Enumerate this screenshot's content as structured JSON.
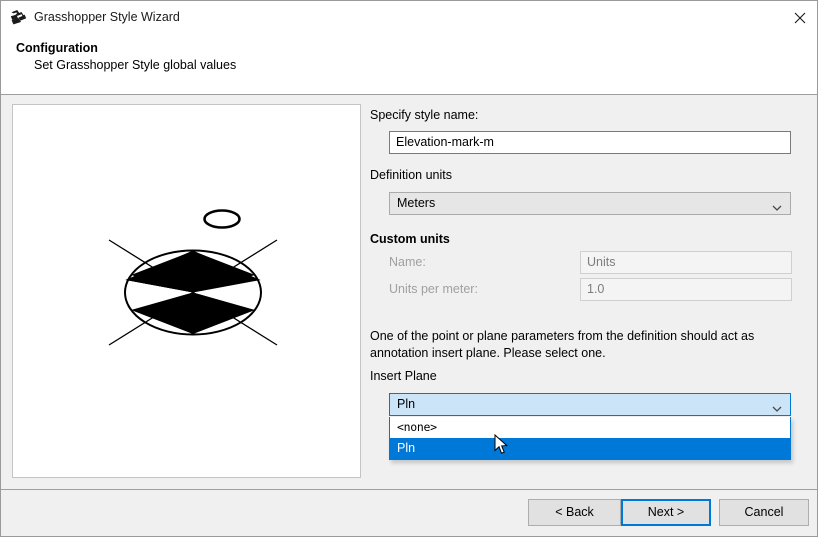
{
  "window": {
    "title": "Grasshopper Style Wizard",
    "app_icon": "grasshopper-icon",
    "close_label": "✕"
  },
  "header": {
    "title": "Configuration",
    "subtitle": "Set Grasshopper Style global values"
  },
  "preview": {
    "name": "style-preview-elevation-mark"
  },
  "form": {
    "style_name_label": "Specify style name:",
    "style_name_value": "Elevation-mark-m",
    "definition_units_label": "Definition units",
    "definition_units_value": "Meters",
    "custom_units_label": "Custom units",
    "custom_name_label": "Name:",
    "custom_name_value": "Units",
    "units_per_meter_label": "Units per meter:",
    "units_per_meter_value": "1.0",
    "insert_plane_description": "One of the point or plane parameters from the definition should act as annotation insert plane. Please select one.",
    "insert_plane_label": "Insert Plane",
    "insert_plane_value": "Pln",
    "insert_plane_options": [
      {
        "label": "<none>",
        "selected": false
      },
      {
        "label": "Pln",
        "selected": true
      }
    ]
  },
  "footer": {
    "back_label": "< Back",
    "next_label": "Next >",
    "cancel_label": "Cancel"
  },
  "colors": {
    "accent": "#0078d7",
    "dialog_bg": "#f0f0f0",
    "titlebar_bg": "#ffffff",
    "combo_open_bg": "#cce4f7",
    "selection_bg": "#0078d7"
  }
}
